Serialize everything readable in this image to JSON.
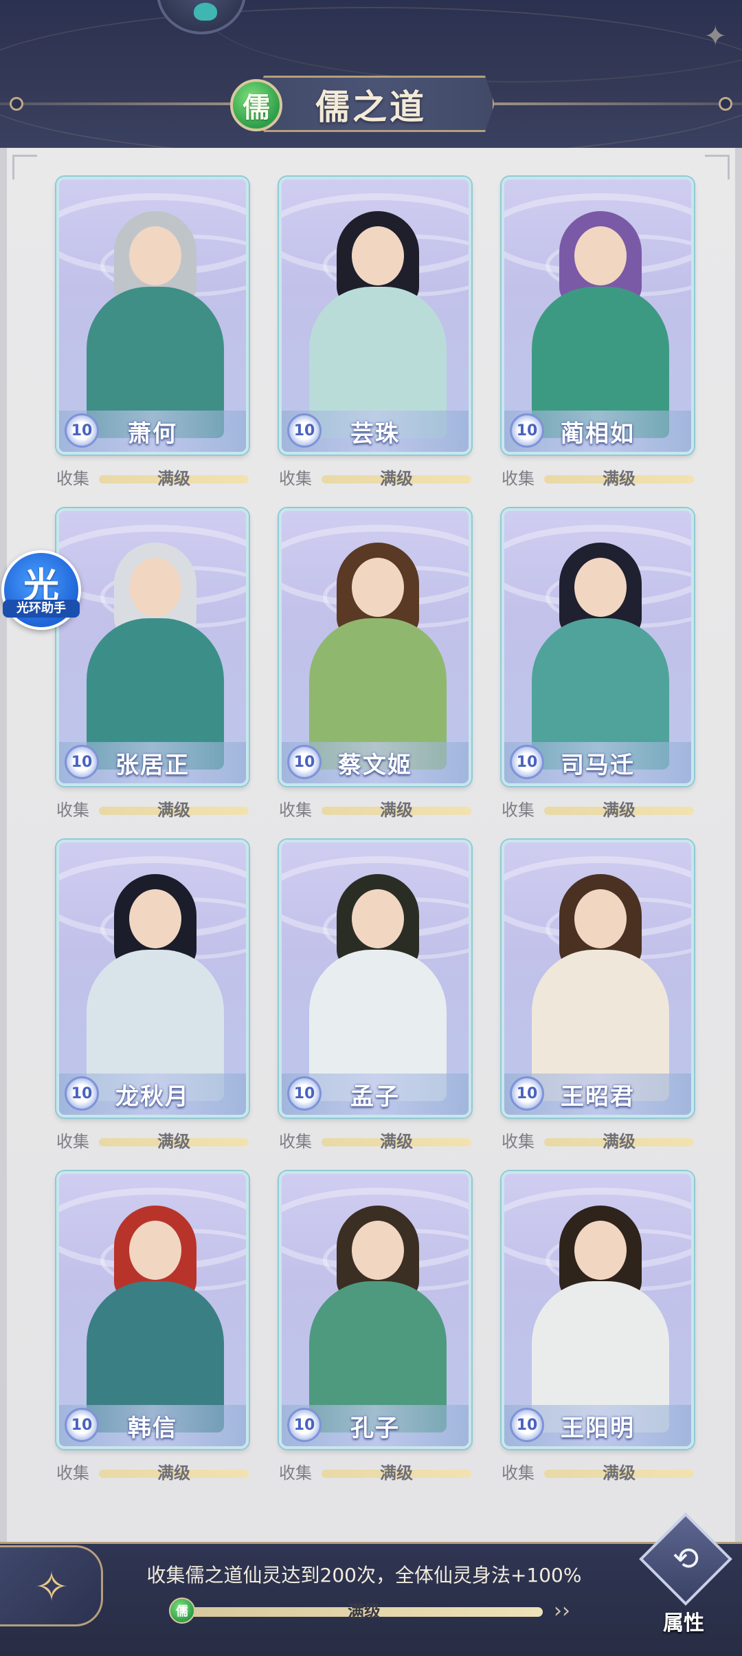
{
  "header": {
    "title": "儒之道",
    "badge": "儒"
  },
  "helper": {
    "glyph": "光",
    "label": "光环助手"
  },
  "cards": [
    {
      "name": "萧何",
      "level": "10",
      "collect_label": "收集",
      "status": "满级",
      "progress": 1.0,
      "hair": "#bfc4c9",
      "robe": "#3f8f86"
    },
    {
      "name": "芸珠",
      "level": "10",
      "collect_label": "收集",
      "status": "满级",
      "progress": 1.0,
      "hair": "#1f1f2c",
      "robe": "#b9dcd8"
    },
    {
      "name": "蔺相如",
      "level": "10",
      "collect_label": "收集",
      "status": "满级",
      "progress": 1.0,
      "hair": "#7a5aa6",
      "robe": "#3d9a82"
    },
    {
      "name": "张居正",
      "level": "10",
      "collect_label": "收集",
      "status": "满级",
      "progress": 1.0,
      "hair": "#d9dde2",
      "robe": "#3c8f88"
    },
    {
      "name": "蔡文姬",
      "level": "10",
      "collect_label": "收集",
      "status": "满级",
      "progress": 1.0,
      "hair": "#5b3a25",
      "robe": "#8fb86e"
    },
    {
      "name": "司马迁",
      "level": "10",
      "collect_label": "收集",
      "status": "满级",
      "progress": 1.0,
      "hair": "#1f2030",
      "robe": "#4fa39a"
    },
    {
      "name": "龙秋月",
      "level": "10",
      "collect_label": "收集",
      "status": "满级",
      "progress": 1.0,
      "hair": "#1b1d2a",
      "robe": "#d8e4ea"
    },
    {
      "name": "孟子",
      "level": "10",
      "collect_label": "收集",
      "status": "满级",
      "progress": 1.0,
      "hair": "#2a2d24",
      "robe": "#e8eef0"
    },
    {
      "name": "王昭君",
      "level": "10",
      "collect_label": "收集",
      "status": "满级",
      "progress": 1.0,
      "hair": "#4a3122",
      "robe": "#efe7da"
    },
    {
      "name": "韩信",
      "level": "10",
      "collect_label": "收集",
      "status": "满级",
      "progress": 1.0,
      "hair": "#b8342a",
      "robe": "#3a7f84"
    },
    {
      "name": "孔子",
      "level": "10",
      "collect_label": "收集",
      "status": "满级",
      "progress": 1.0,
      "hair": "#3b2e22",
      "robe": "#4d9a7f"
    },
    {
      "name": "王阳明",
      "level": "10",
      "collect_label": "收集",
      "status": "满级",
      "progress": 1.0,
      "hair": "#2e241c",
      "robe": "#e9ecea"
    }
  ],
  "bottom": {
    "bonus_text": "收集儒之道仙灵达到200次，全体仙灵身法+100%",
    "progress_icon": "儒",
    "progress_status": "满级",
    "progress": 1.0,
    "arrows": "››",
    "attr_symbol": "⟲",
    "attr_label": "属性"
  },
  "colors": {
    "accent_gold": "#b79f7c",
    "title_green": "#2f9e4a",
    "card_border": "#8fcad6"
  }
}
